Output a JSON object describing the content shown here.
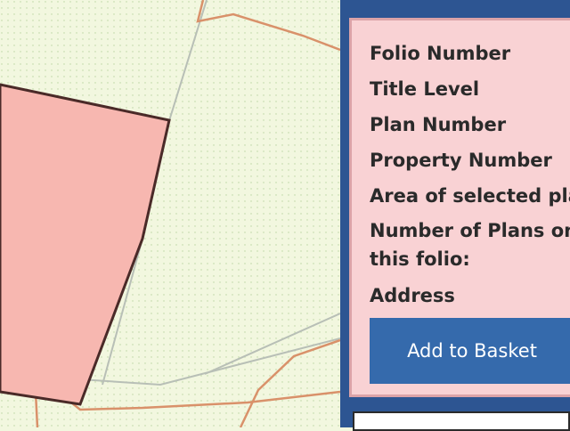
{
  "map": {
    "background": "#f2f7df",
    "selected_parcel_fill": "#f7b7b0",
    "selected_parcel_stroke": "#4a2a28",
    "road_color": "#d9916a",
    "boundary_color": "#b8bfb6"
  },
  "panel": {
    "background": "#2d5592",
    "card_background": "#f9d2d4",
    "fields": [
      {
        "label": "Folio Number"
      },
      {
        "label": "Title Level"
      },
      {
        "label": "Plan Number"
      },
      {
        "label": "Property Number"
      },
      {
        "label": "Area of selected pla"
      },
      {
        "label": "Number of Plans on this folio:"
      },
      {
        "label": "Address"
      }
    ],
    "add_button_label": "Add to Basket",
    "button_color": "#356aac"
  }
}
